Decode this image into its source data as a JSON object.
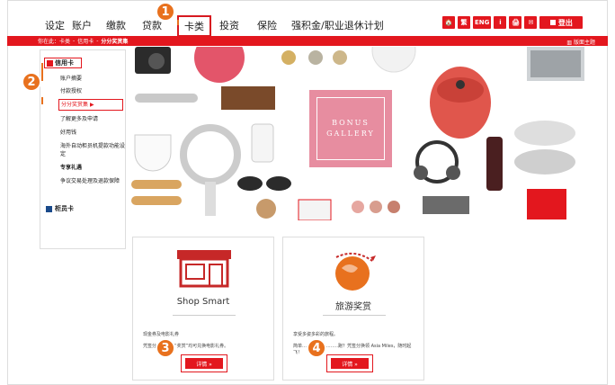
{
  "nav": {
    "items": [
      "设定",
      "账户",
      "缴款",
      "贷款",
      "卡类",
      "投资",
      "保险",
      "强积金/职业退休计划"
    ],
    "active_index": 4,
    "tools": [
      "🏠",
      "繁",
      "ENG",
      "i",
      "🖨",
      "✉"
    ],
    "logout_label": "登出"
  },
  "breadcrumb": {
    "prefix": "你在此：",
    "items": [
      "卡类",
      "信用卡",
      "分分奖赏集"
    ],
    "right_label": "版面主题"
  },
  "sidebar": {
    "heading": "信用卡",
    "items": [
      "账户摘要",
      "付款授权",
      "分分奖赏集",
      "了解更多及申请",
      "好用钱",
      "海外自动柜员机提款功能设定",
      "专享礼遇",
      "争议交易处理及退款保障"
    ],
    "selected_index": 2,
    "section2": "柜员卡"
  },
  "collage": {
    "bonus_line1": "BONUS",
    "bonus_line2": "GALLERY"
  },
  "cards": [
    {
      "title": "Shop Smart",
      "line1": "现金券及电影礼券",
      "line2": "凭签分…………“奖赏”均可兑换电影礼券。",
      "button": "详情 »"
    },
    {
      "title": "旅游奖赏",
      "line1": "享受多姿多彩的旅程。",
      "line2": "简单……………………跑？凭签分换领 Asia Miles，随时起",
      "line3": "飞！",
      "button": "详情 »"
    }
  ],
  "callouts": [
    "1",
    "2",
    "3",
    "4"
  ],
  "colors": {
    "brand_red": "#e3171e",
    "callout_orange": "#e8711e",
    "bonus_pink": "#e78da0"
  }
}
